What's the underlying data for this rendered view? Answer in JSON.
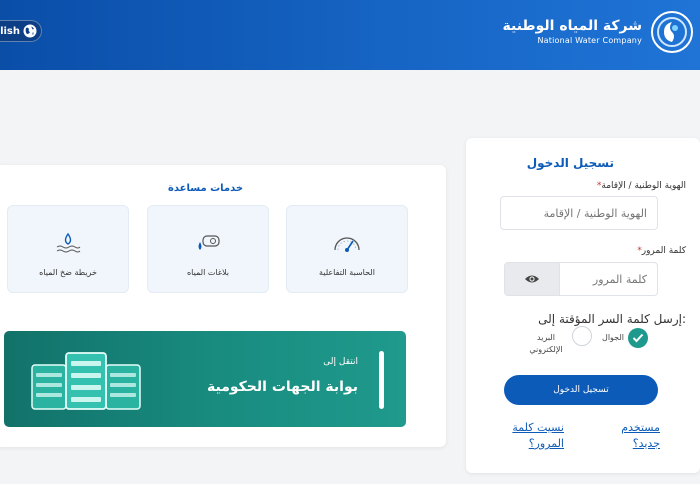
{
  "header": {
    "lang_button": "lish",
    "brand_ar": "شركة المياه الوطنية",
    "brand_en": "National Water Company"
  },
  "login": {
    "title": "تسجيل الدخول",
    "id_label": "الهوية الوطنية / الإقامة",
    "id_placeholder": "الهوية الوطنية / الإقامة",
    "password_label": "كلمة المرور",
    "password_placeholder": "كلمة المرور",
    "send_otp_label": "إرسل كلمة السر المؤقتة إلى:",
    "otp_options": [
      {
        "label": "الجوال",
        "selected": true
      },
      {
        "label": "البريد الإلكتروني",
        "selected": false
      }
    ],
    "submit": "تسجيل الدخول",
    "new_user_link": "مستخدم جديد؟",
    "forgot_password_link": "نسيت كلمة المرور؟"
  },
  "services": {
    "title": "خدمات مساعدة",
    "items": [
      {
        "label": "الحاسبة التفاعلية",
        "icon": "gauge-icon"
      },
      {
        "label": "بلاغات المياه",
        "icon": "water-report-icon"
      },
      {
        "label": "خريطة ضخ المياه",
        "icon": "water-map-icon"
      }
    ]
  },
  "gov_portal": {
    "small": "انتقل إلى",
    "big": "بوابة الجهات الحكومية"
  },
  "colors": {
    "primary": "#0d5bb8",
    "teal": "#198c80",
    "required": "#d32f2f"
  }
}
